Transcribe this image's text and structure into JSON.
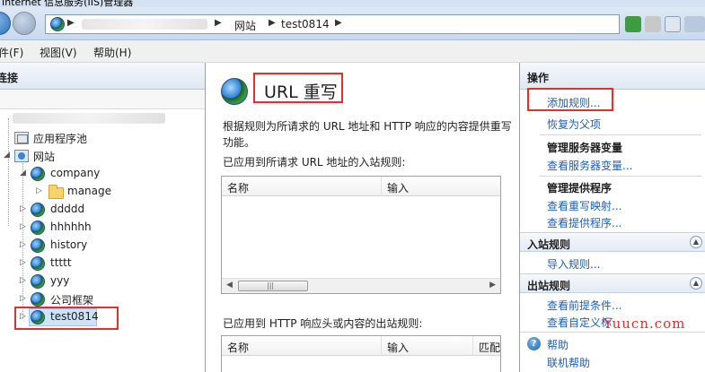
{
  "window": {
    "title": "Internet 信息服务(IIS)管理器"
  },
  "address": {
    "crumbs": [
      "网站",
      "test0814"
    ]
  },
  "menu": {
    "file": "文件(F)",
    "view": "视图(V)",
    "help": "帮助(H)"
  },
  "left_panel": {
    "title": "连接",
    "tree": {
      "app_pools": "应用程序池",
      "sites": "网站",
      "items": [
        {
          "label": "company"
        },
        {
          "label": "manage"
        },
        {
          "label": "ddddd"
        },
        {
          "label": "hhhhhh"
        },
        {
          "label": "history"
        },
        {
          "label": "ttttt"
        },
        {
          "label": "yyy"
        },
        {
          "label": "公司框架"
        },
        {
          "label": "test0814"
        }
      ]
    }
  },
  "center": {
    "title": "URL 重写",
    "description": "根据规则为所请求的 URL 地址和 HTTP 响应的内容提供重写功能。",
    "inbound_label": "已应用到所请求 URL 地址的入站规则:",
    "inbound_columns": [
      "名称",
      "输入"
    ],
    "outbound_label": "已应用到 HTTP 响应头或内容的出站规则:",
    "outbound_columns": [
      "名称",
      "输入",
      "匹配"
    ]
  },
  "right_panel": {
    "title": "操作",
    "add_rule": "添加规则...",
    "revert_parent": "恢复为父项",
    "server_vars_heading": "管理服务器变量",
    "view_server_vars": "查看服务器变量...",
    "providers_heading": "管理提供程序",
    "view_rewrite_maps": "查看重写映射...",
    "view_providers": "查看提供程序...",
    "inbound_section": "入站规则",
    "import_rules": "导入规则...",
    "outbound_section": "出站规则",
    "view_preconditions": "查看前提条件...",
    "view_custom_tags": "查看自定义标",
    "help": "帮助",
    "online_help": "联机帮助"
  },
  "watermark": "Yuucn.com",
  "colors": {
    "link": "#1f5fb3",
    "highlight_box": "#e03030",
    "selection": "#cce4f7"
  }
}
